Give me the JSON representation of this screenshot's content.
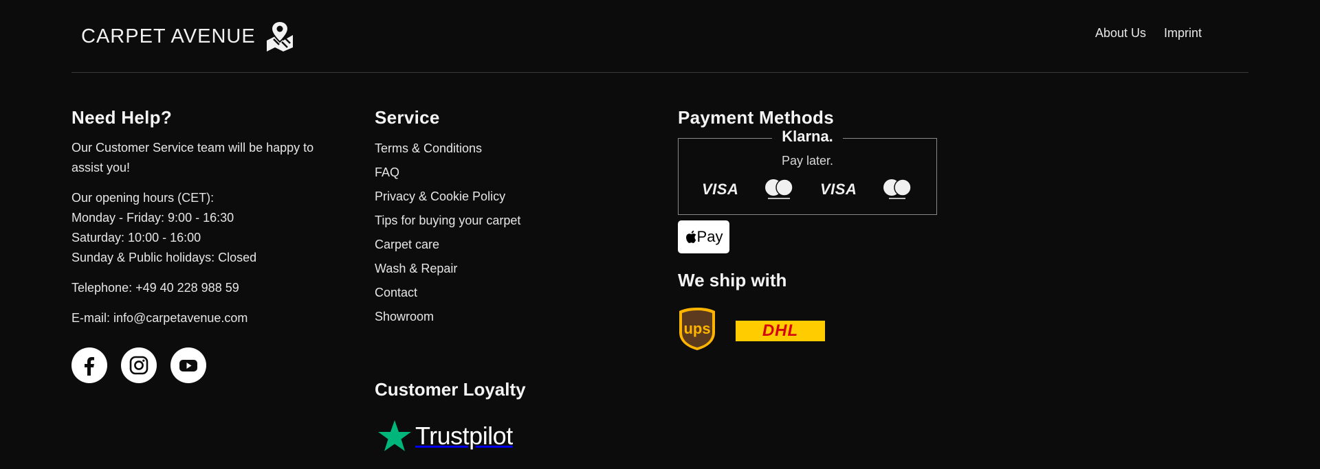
{
  "header": {
    "brand": "CARPET AVENUE",
    "links": [
      "About Us",
      "Imprint"
    ]
  },
  "help": {
    "title": "Need Help?",
    "intro": "Our Customer Service team will be happy to assist you!",
    "hours_title": "Our opening hours (CET):",
    "hours": [
      "Monday - Friday: 9:00 - 16:30",
      "Saturday: 10:00 - 16:00",
      "Sunday & Public holidays: Closed"
    ],
    "telephone": "Telephone: +49 40 228 988 59",
    "email": "E-mail: info@carpetavenue.com",
    "socials": [
      "facebook-icon",
      "instagram-icon",
      "youtube-icon"
    ]
  },
  "service": {
    "title": "Service",
    "links": [
      "Terms & Conditions",
      "FAQ",
      "Privacy & Cookie Policy",
      "Tips for buying your carpet",
      "Carpet care",
      "Wash & Repair",
      "Contact",
      "Showroom"
    ]
  },
  "loyalty": {
    "title": "Customer Loyalty",
    "trustpilot_label": "Trustpilot",
    "star_color": "#00b67a"
  },
  "payment": {
    "title": "Payment Methods",
    "klarna": "Klarna.",
    "klarna_tagline": "Pay later.",
    "cards": [
      "VISA",
      "mastercard",
      "VISA Electron",
      "maestro"
    ],
    "visa_label": "VISA",
    "applepay_label": "Pay"
  },
  "shipping": {
    "title": "We ship with",
    "carriers": [
      "UPS",
      "DHL"
    ],
    "dhl_label": "DHL",
    "ups_label": "ups"
  }
}
